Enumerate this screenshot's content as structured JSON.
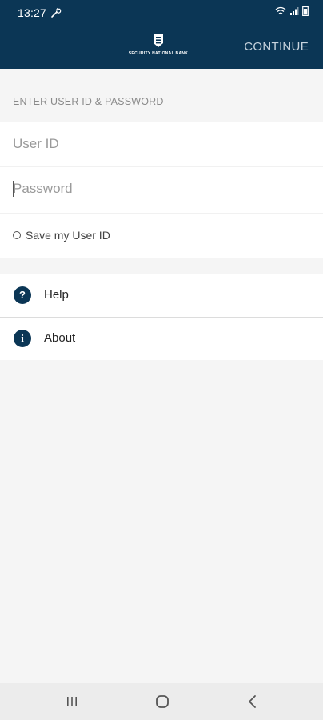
{
  "status_bar": {
    "time": "13:27"
  },
  "header": {
    "logo_text": "SECURITY NATIONAL BANK",
    "continue_label": "CONTINUE"
  },
  "login": {
    "section_label": "ENTER USER ID & PASSWORD",
    "user_id_placeholder": "User ID",
    "password_placeholder": "Password",
    "save_user_id_label": "Save my User ID",
    "save_user_id_checked": false
  },
  "menu": {
    "items": [
      {
        "label": "Help",
        "icon": "help-icon"
      },
      {
        "label": "About",
        "icon": "info-icon"
      }
    ]
  },
  "colors": {
    "brand": "#0b3655",
    "background": "#f5f5f5"
  }
}
